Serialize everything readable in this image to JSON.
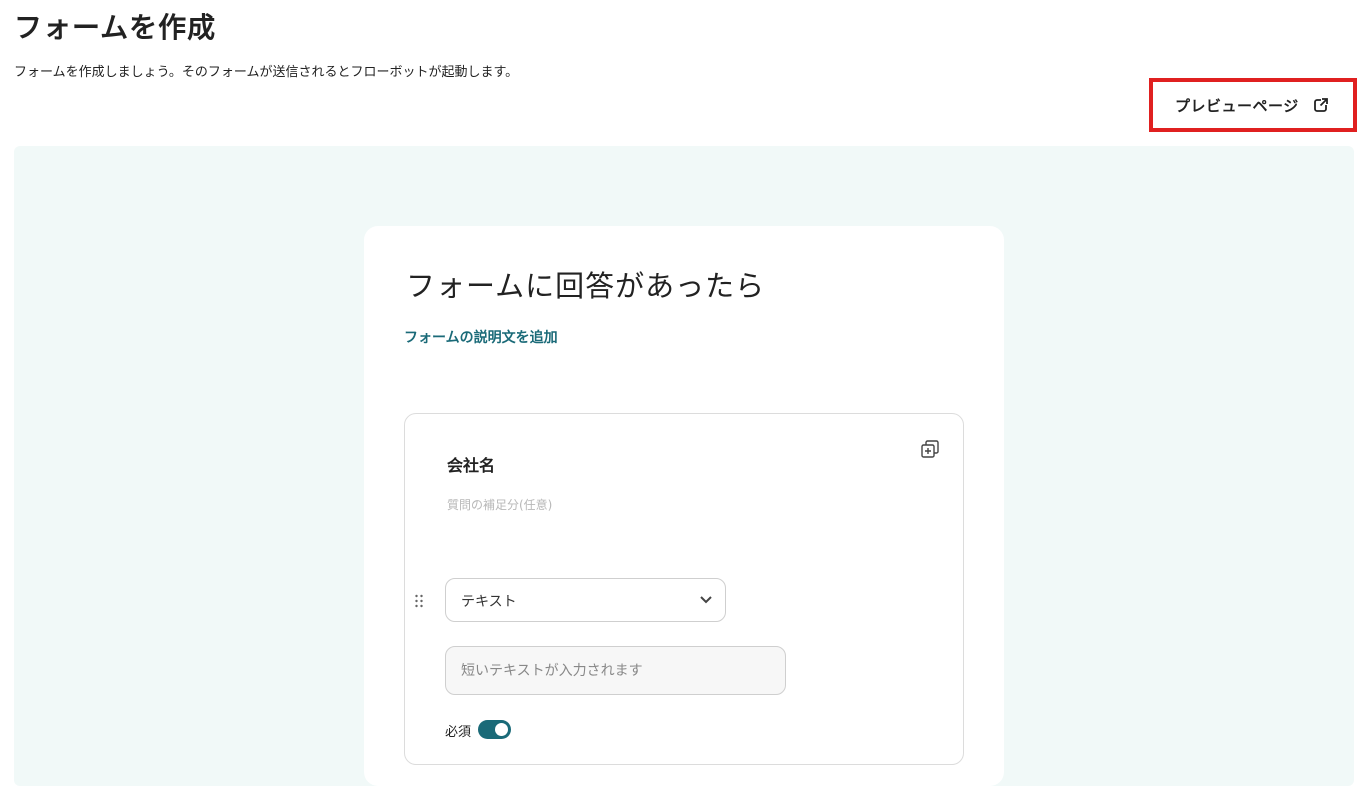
{
  "header": {
    "title": "フォームを作成",
    "subtitle": "フォームを作成しましょう。そのフォームが送信されるとフローボットが起動します。",
    "preview_button_label": "プレビューページ",
    "preview_icon": "external-link-icon"
  },
  "form": {
    "title": "フォームに回答があったら",
    "add_description_label": "フォームの説明文を追加",
    "question": {
      "title": "会社名",
      "description_placeholder": "質問の補足分(任意)",
      "type_selected": "テキスト",
      "answer_placeholder": "短いテキストが入力されます",
      "required_label": "必須",
      "required_on": true,
      "icons": {
        "copy": "copy-icon",
        "drag": "drag-handle-icon",
        "select_chevron": "chevron-down-icon"
      }
    }
  },
  "colors": {
    "accent": "#1a6a78",
    "canvas_bg": "#f1f9f8",
    "highlight_border": "#e02020"
  }
}
